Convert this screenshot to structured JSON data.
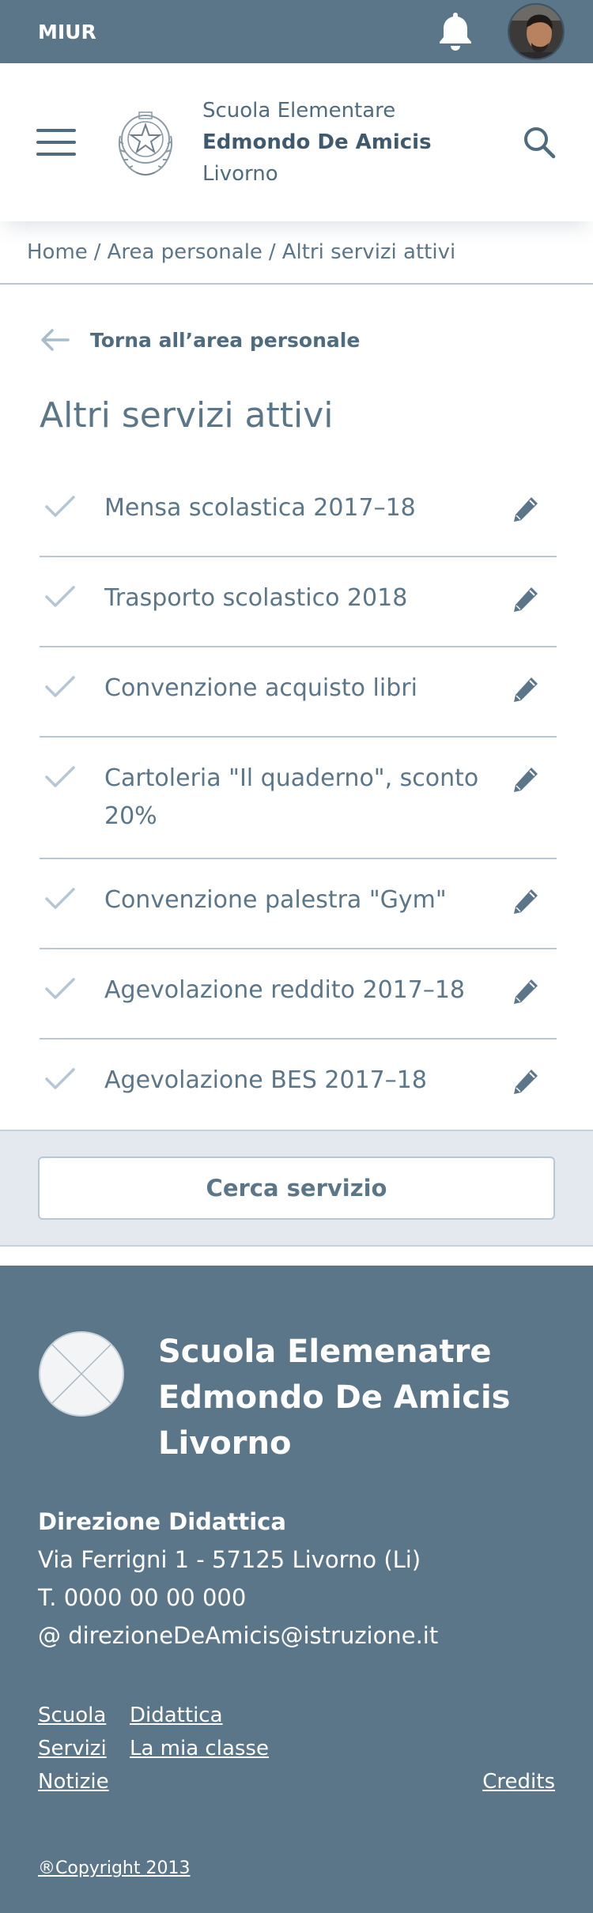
{
  "topbar": {
    "brand": "MIUR",
    "notification_icon": "bell-icon",
    "avatar_icon": "user-avatar"
  },
  "header": {
    "menu_icon": "hamburger-menu-icon",
    "emblem_icon": "italian-republic-emblem",
    "school_line1": "Scuola Elementare",
    "school_line2": "Edmondo De Amicis",
    "school_line3": "Livorno",
    "search_icon": "search-icon"
  },
  "breadcrumb": {
    "items": [
      "Home",
      "Area personale",
      "Altri servizi attivi"
    ],
    "separator": "/"
  },
  "back_link": {
    "label": "Torna all’area personale",
    "icon": "arrow-left-icon"
  },
  "page_title": "Altri servizi attivi",
  "services": [
    "Mensa scolastica 2017–18",
    "Trasporto scolastico 2018",
    "Convenzione acquisto libri",
    "Cartoleria \"Il quaderno\", sconto 20%",
    "Convenzione palestra \"Gym\"",
    "Agevolazione reddito 2017–18",
    "Agevolazione BES 2017–18"
  ],
  "search_button": "Cerca servizio",
  "footer": {
    "title_line1": "Scuola Elemenatre",
    "title_line2": "Edmondo De Amicis",
    "title_line3": "Livorno",
    "direction": "Direzione Didattica",
    "address": "Via Ferrigni 1 - 57125 Livorno (Li)",
    "phone": "T. 0000 00 00 000",
    "email": "@ direzioneDeAmicis@istruzione.it",
    "links": {
      "scuola": "Scuola",
      "didattica": "Didattica",
      "servizi": "Servizi",
      "la_mia_classe": "La mia classe",
      "notizie": "Notizie",
      "credits": "Credits"
    },
    "copyright": "®Copyright 2013"
  },
  "colors": {
    "primary": "#5b7589",
    "text": "#5c7a90",
    "band": "#e4e9f0",
    "divider": "#b9c7d2"
  }
}
